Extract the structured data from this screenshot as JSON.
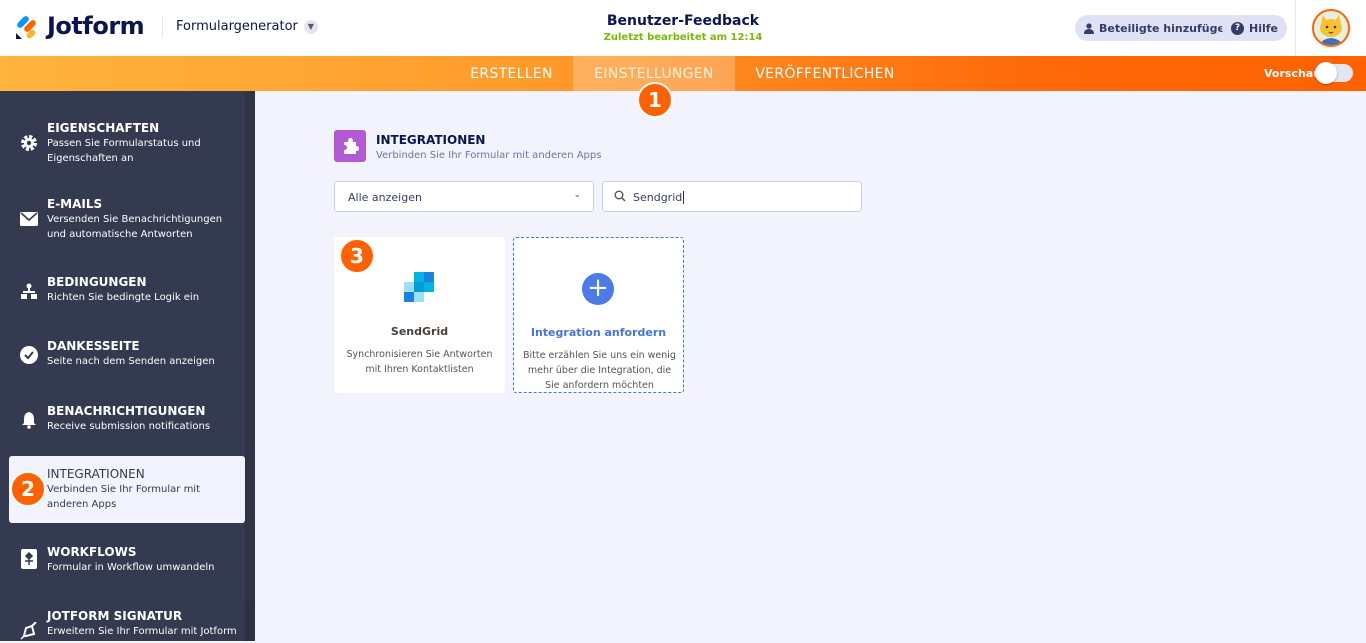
{
  "header": {
    "brand": "Jotform",
    "builder": "Formulargenerator",
    "form_title": "Benutzer-Feedback",
    "last_edited": "Zuletzt bearbeitet am 12:14",
    "add_participants": "Beteiligte hinzufügen",
    "help": "Hilfe"
  },
  "nav": {
    "tabs": [
      "ERSTELLEN",
      "EINSTELLUNGEN",
      "VERÖFFENTLICHEN"
    ],
    "active_tab": "EINSTELLUNGEN",
    "preview_label": "Vorschau",
    "preview_on": false
  },
  "badges": [
    "1",
    "2",
    "3"
  ],
  "sidebar": {
    "items": [
      {
        "title": "EIGENSCHAFTEN",
        "desc": "Passen Sie Formularstatus und Eigenschaften an",
        "icon": "gear-icon"
      },
      {
        "title": "E-MAILS",
        "desc": "Versenden Sie Benachrichtigungen und automatische Antworten",
        "icon": "mail-icon"
      },
      {
        "title": "BEDINGUNGEN",
        "desc": "Richten Sie bedingte Logik ein",
        "icon": "sitemap-icon"
      },
      {
        "title": "DANKESSEITE",
        "desc": "Seite nach dem Senden anzeigen",
        "icon": "check-circle-icon"
      },
      {
        "title": "BENACHRICHTIGUNGEN",
        "desc": "Receive submission notifications",
        "icon": "bell-icon"
      },
      {
        "title": "INTEGRATIONEN",
        "desc": "Verbinden Sie Ihr Formular mit anderen Apps",
        "icon": "puzzle-icon"
      },
      {
        "title": "WORKFLOWS",
        "desc": "Formular in Workflow umwandeln",
        "icon": "workflow-icon"
      },
      {
        "title": "JOTFORM SIGNATUR",
        "desc": "Erweitern Sie Ihr Formular mit Jotform",
        "icon": "pen-icon"
      }
    ],
    "active": "INTEGRATIONEN"
  },
  "main": {
    "section_title": "INTEGRATIONEN",
    "section_sub": "Verbinden Sie Ihr Formular mit anderen Apps",
    "filter": "Alle anzeigen",
    "search_value": "Sendgrid",
    "cards": [
      {
        "name": "SendGrid",
        "desc": "Synchronisieren Sie Antworten mit Ihren Kontaktlisten"
      },
      {
        "name": "Integration anfordern",
        "desc": "Bitte erzählen Sie uns ein wenig mehr über die Integration, die Sie anfordern möchten"
      }
    ]
  },
  "colors": {
    "accent": "#ff6100",
    "sidebar": "#343a4f",
    "link": "#4573e3"
  }
}
